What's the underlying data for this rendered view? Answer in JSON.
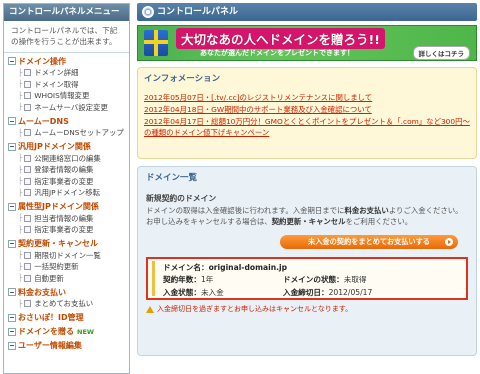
{
  "sidebar": {
    "title": "コントロールパネルメニュー",
    "description": "コントロールパネルでは、下記の操作を行うことが出来ます。",
    "sections": [
      {
        "label": "ドメイン操作",
        "items": [
          "ドメイン詳細",
          "ドメイン取得",
          "WHOIS情報変更",
          "ネームサーバ設定変更"
        ]
      },
      {
        "label": "ムームーDNS",
        "items": [
          "ムームーDNSセットアップ"
        ]
      },
      {
        "label": "汎用JPドメイン関係",
        "items": [
          "公開連絡窓口の編集",
          "登録者情報の編集",
          "指定事業者の変更",
          "汎用JPドメイン移転"
        ]
      },
      {
        "label": "属性型JPドメイン関係",
        "items": [
          "担当者情報の編集",
          "指定事業者の変更"
        ]
      },
      {
        "label": "契約更新・キャンセル",
        "items": [
          "期限切ドメイン一覧",
          "一括契約更新",
          "自動更新"
        ]
      },
      {
        "label": "料金お支払い",
        "items": [
          "まとめてお支払い"
        ]
      },
      {
        "label": "おさいぽ！ID管理",
        "items": []
      },
      {
        "label": "ドメインを贈る",
        "items": [],
        "badge": "NEW"
      },
      {
        "label": "ユーザー情報編集",
        "items": []
      }
    ]
  },
  "header": {
    "title": "コントロールパネル"
  },
  "banner": {
    "headline": "大切なあの人へドメインを贈ろう!!",
    "subline": "あなたが選んだドメインをプレゼントできます！",
    "more_label": "詳しくはコチラ"
  },
  "info": {
    "title": "インフォメーション",
    "news": [
      "2012年05月07日・[.tv/.cc]のレジストリメンテナンスに関しまして",
      "2012年04月18日・GW期間中のサポート業務及び入金確認について",
      "2012年04月17日・総額10万円分！GMOとくとくポイントをプレゼント＆「.com」など300円〜の種類のドメイン値下げキャンペーン"
    ]
  },
  "domains": {
    "title": "ドメイン一覧",
    "new_contract_heading": "新規契約のドメイン",
    "line1": "ドメインの取得は入金確認後に行われます。入金期日までに",
    "line1_bold": "料金お支払い",
    "line1_end": "よりご入金ください。",
    "line2": "お申し込みをキャンセルする場合は、",
    "line2_bold": "契約更新・キャンセル",
    "line2_end": "をご利用ください。",
    "pay_button": "未入金の契約をまとめてお支払いする",
    "card": {
      "name_label": "ドメイン名：",
      "name_value": "original-domain.jp",
      "years_label": "契約年数：",
      "years_value": "1年",
      "status_label": "ドメインの状態：",
      "status_value": "未取得",
      "payment_label": "入金状態：",
      "payment_value": "未入金",
      "deadline_label": "入金締切日：",
      "deadline_value": "2012/05/17"
    },
    "warning": "入金締切日を過ぎますとお申し込みはキャンセルとなります。"
  }
}
